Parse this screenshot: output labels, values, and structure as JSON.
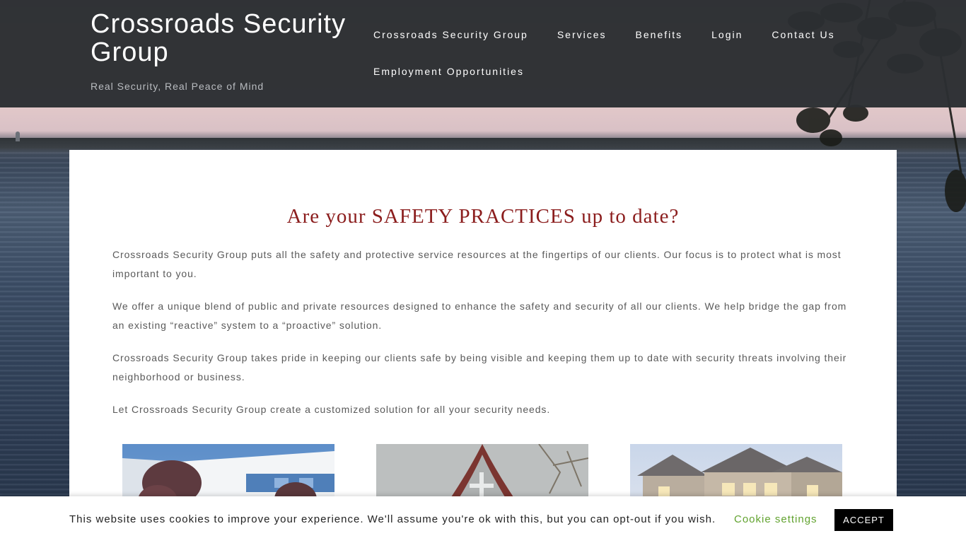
{
  "header": {
    "site_title": "Crossroads Security Group",
    "tagline": "Real Security, Real Peace of Mind",
    "nav_items": [
      "Crossroads Security Group",
      "Services",
      "Benefits",
      "Login",
      "Contact Us",
      "Employment Opportunities"
    ]
  },
  "main": {
    "heading": "Are your SAFETY PRACTICES up to date?",
    "paragraphs": [
      "Crossroads Security Group puts all the safety and protective service resources at the fingertips of our clients. Our focus is to protect what is most important to you.",
      "We offer a unique blend of public and private resources designed to enhance the safety and security of all our clients. We help bridge the gap from an existing “reactive” system to a “proactive” solution.",
      "Crossroads Security Group takes pride in keeping our clients safe by being visible and keeping them up to date with security threats involving their neighborhood or business.",
      "Let Crossroads Security Group create a customized solution for all your security needs."
    ]
  },
  "cookie_bar": {
    "message": "This website uses cookies to improve your experience. We'll assume you're ok with this, but you can opt-out if you wish.",
    "settings_label": "Cookie settings",
    "accept_label": "ACCEPT"
  },
  "colors": {
    "header_bg": "#2b2e32",
    "heading": "#8b1d1d",
    "body_text": "#5a5a5a",
    "cookie_link": "#62a330",
    "accept_bg": "#000000"
  }
}
